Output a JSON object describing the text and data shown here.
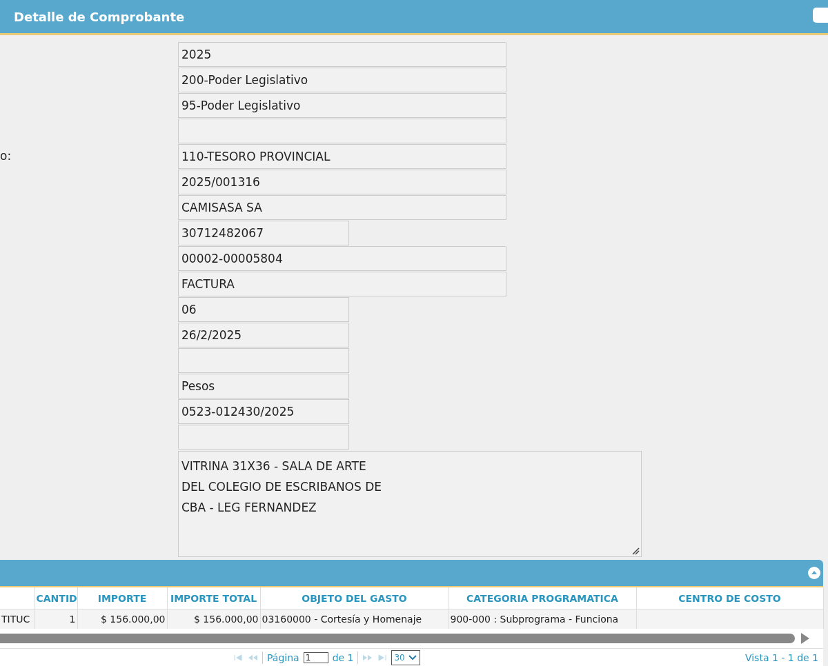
{
  "header": {
    "title": "Detalle de Comprobante"
  },
  "label_fragment": "o:",
  "fields": [
    {
      "value": "2025",
      "kind": "long"
    },
    {
      "value": "200-Poder Legislativo",
      "kind": "long"
    },
    {
      "value": "95-Poder Legislativo",
      "kind": "long"
    },
    {
      "kind": "long"
    },
    {
      "value": "110-TESORO PROVINCIAL",
      "kind": "long"
    },
    {
      "value": "2025/001316",
      "kind": "long"
    },
    {
      "value": "CAMISASA SA",
      "kind": "long"
    },
    {
      "value": "30712482067",
      "kind": "short"
    },
    {
      "value": "00002-00005804",
      "kind": "long"
    },
    {
      "value": "FACTURA",
      "kind": "long"
    },
    {
      "value": "06",
      "kind": "short"
    },
    {
      "value": "26/2/2025",
      "kind": "short"
    },
    {
      "kind": "short"
    },
    {
      "value": "Pesos",
      "kind": "short"
    },
    {
      "value": "0523-012430/2025",
      "kind": "short"
    },
    {
      "kind": "short"
    }
  ],
  "description": [
    "VITRINA 31X36 - SALA DE ARTE",
    "DEL COLEGIO DE ESCRIBANOS DE",
    "CBA - LEG FERNANDEZ"
  ],
  "table": {
    "columns": [
      "",
      "CANTID",
      "IMPORTE",
      "IMPORTE TOTAL",
      "OBJETO DEL GASTO",
      "CATEGORIA PROGRAMATICA",
      "CENTRO DE COSTO"
    ],
    "rows": [
      [
        "TITUC",
        "1",
        "$ 156.000,00",
        "$ 156.000,00",
        "03160000 - Cortesía y Homenaje",
        "900-000 : Subprograma - Funciona",
        ""
      ]
    ]
  },
  "pager": {
    "page_label": "Página",
    "page": "1",
    "of": "de 1",
    "page_size": "30",
    "summary": "Vista 1 - 1 de 1"
  }
}
